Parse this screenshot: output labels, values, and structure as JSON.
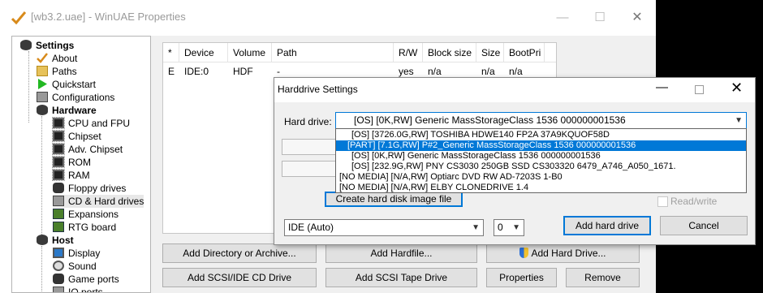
{
  "window": {
    "title": "[wb3.2.uae] - WinUAE Properties",
    "min_glyph": "—",
    "max_glyph": "☐",
    "close_glyph": "✕"
  },
  "tree": {
    "items": [
      {
        "label": "Settings",
        "icon": "settings-icon"
      },
      {
        "label": "About",
        "icon": "checkmark-icon"
      },
      {
        "label": "Paths",
        "icon": "paths-icon"
      },
      {
        "label": "Quickstart",
        "icon": "play-icon"
      },
      {
        "label": "Configurations",
        "icon": "configurations-icon"
      },
      {
        "label": "Hardware",
        "icon": "hardware-icon"
      },
      {
        "label": "CPU and FPU",
        "icon": "chip-icon"
      },
      {
        "label": "Chipset",
        "icon": "chip-icon"
      },
      {
        "label": "Adv. Chipset",
        "icon": "chip-icon"
      },
      {
        "label": "ROM",
        "icon": "chip-icon"
      },
      {
        "label": "RAM",
        "icon": "chip-icon"
      },
      {
        "label": "Floppy drives",
        "icon": "floppy-icon"
      },
      {
        "label": "CD & Hard drives",
        "icon": "hard-drive-icon"
      },
      {
        "label": "Expansions",
        "icon": "board-icon"
      },
      {
        "label": "RTG board",
        "icon": "board-icon"
      },
      {
        "label": "Host",
        "icon": "host-icon"
      },
      {
        "label": "Display",
        "icon": "display-icon"
      },
      {
        "label": "Sound",
        "icon": "sound-icon"
      },
      {
        "label": "Game ports",
        "icon": "gamepad-icon"
      },
      {
        "label": "IO ports",
        "icon": "io-icon"
      }
    ]
  },
  "drive_list": {
    "headers": [
      "*",
      "Device",
      "Volume",
      "Path",
      "R/W",
      "Block size",
      "Size",
      "BootPri"
    ],
    "rows": [
      [
        "E",
        "IDE:0",
        "HDF",
        "-",
        "yes",
        "n/a",
        "n/a",
        "n/a"
      ]
    ]
  },
  "buttons": {
    "add_directory": "Add Directory or Archive...",
    "add_hardfile": "Add Hardfile...",
    "add_hard_drive": "Add Hard Drive...",
    "add_cd": "Add SCSI/IDE CD Drive",
    "add_tape": "Add SCSI Tape Drive",
    "properties": "Properties",
    "remove": "Remove"
  },
  "dialog": {
    "title": "Harddrive Settings",
    "hard_drive_label": "Hard drive:",
    "hard_drive_value": "[OS] [0K,RW] Generic  MassStorageClass 1536 000000001536",
    "dropdown_options": [
      "[OS] [3726.0G,RW] TOSHIBA HDWE140 FP2A         37A9KQUOF58D",
      "[PART] [7.1G,RW] P#2_Generic  MassStorageClass 1536 000000001536",
      "[OS] [0K,RW] Generic  MassStorageClass 1536 000000001536",
      "[OS] [232.9G,RW] PNY CS3030 250GB SSD CS303320 6479_A746_A050_1671.",
      "[NO MEDIA] [N/A,RW] Optiarc  DVD RW AD-7203S  1-B0",
      "[NO MEDIA] [N/A,RW] ELBY     CLONEDRIVE       1.4"
    ],
    "selected_option_index": 1,
    "create_image_button": "Create hard disk image file",
    "read_write_label": "Read/write",
    "controller_value": "IDE (Auto)",
    "unit_value": "0",
    "add_button": "Add hard drive",
    "cancel_button": "Cancel"
  }
}
